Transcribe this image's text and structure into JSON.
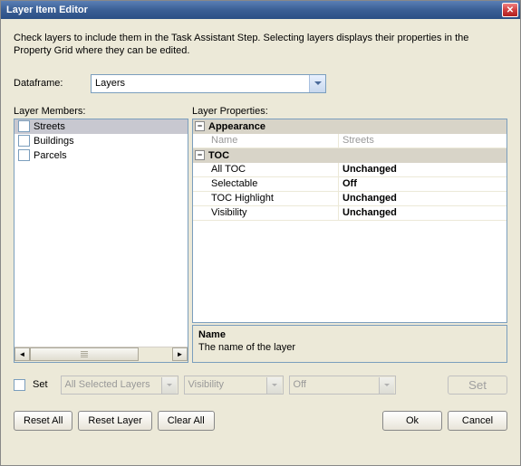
{
  "window": {
    "title": "Layer Item Editor"
  },
  "instruction": "Check layers to include them in the Task Assistant Step. Selecting layers displays their properties in the Property Grid where they can be edited.",
  "dataframe": {
    "label": "Dataframe:",
    "value": "Layers"
  },
  "members": {
    "label": "Layer Members:",
    "items": [
      {
        "name": "Streets",
        "checked": false,
        "selected": true
      },
      {
        "name": "Buildings",
        "checked": false,
        "selected": false
      },
      {
        "name": "Parcels",
        "checked": false,
        "selected": false
      }
    ]
  },
  "properties": {
    "label": "Layer Properties:",
    "sections": {
      "appearance": {
        "title": "Appearance",
        "rows": [
          {
            "name": "Name",
            "value": "Streets",
            "disabled": true
          }
        ]
      },
      "toc": {
        "title": "TOC",
        "rows": [
          {
            "name": "All TOC",
            "value": "Unchanged"
          },
          {
            "name": "Selectable",
            "value": "Off"
          },
          {
            "name": "TOC Highlight",
            "value": "Unchanged"
          },
          {
            "name": "Visibility",
            "value": "Unchanged"
          }
        ]
      }
    },
    "desc": {
      "title": "Name",
      "text": "The name of the layer"
    }
  },
  "setRow": {
    "checkbox": "Set",
    "select1": "All Selected Layers",
    "select2": "Visibility",
    "select3": "Off",
    "button": "Set"
  },
  "buttons": {
    "resetAll": "Reset All",
    "resetLayer": "Reset Layer",
    "clearAll": "Clear All",
    "ok": "Ok",
    "cancel": "Cancel"
  }
}
